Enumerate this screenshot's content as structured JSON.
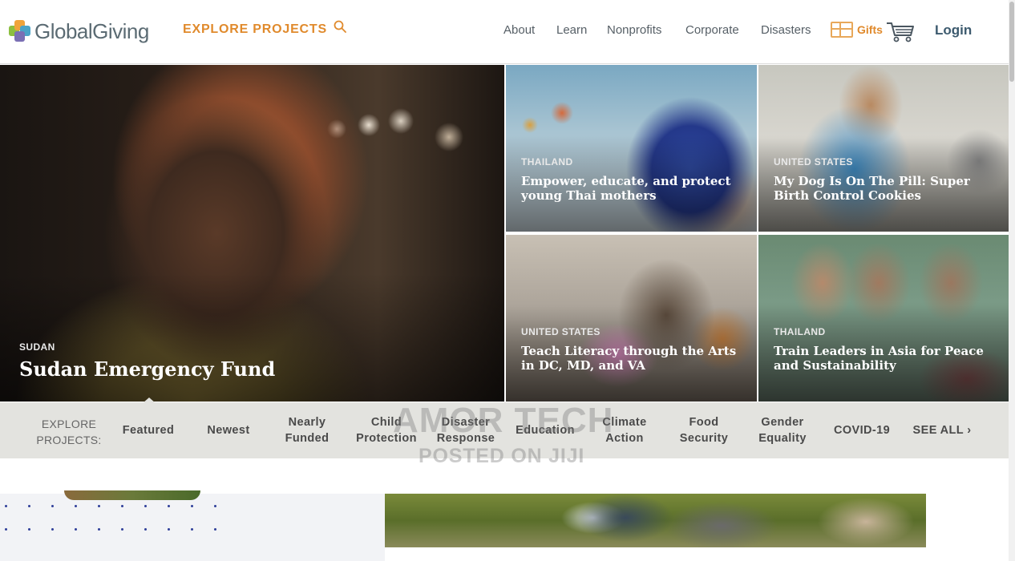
{
  "header": {
    "logo_text": "GlobalGiving",
    "explore_label": "EXPLORE PROJECTS",
    "nav": [
      {
        "label": "About"
      },
      {
        "label": "Learn"
      },
      {
        "label": "Nonprofits"
      },
      {
        "label": "Corporate"
      },
      {
        "label": "Disasters"
      }
    ],
    "gifts_label": "Gifts",
    "login_label": "Login",
    "colors": {
      "accent": "#e08a2c",
      "nav_text": "#565f66",
      "login": "#3c5a6e"
    }
  },
  "hero": {
    "main": {
      "country": "SUDAN",
      "title": "Sudan Emergency Fund"
    },
    "tiles": [
      {
        "country": "THAILAND",
        "title": "Empower, educate, and protect young Thai mothers"
      },
      {
        "country": "UNITED STATES",
        "title": "My Dog Is On The Pill: Super Birth Control Cookies"
      },
      {
        "country": "UNITED STATES",
        "title": "Teach Literacy through the Arts in DC, MD, and VA"
      },
      {
        "country": "THAILAND",
        "title": "Train Leaders in Asia for Peace and Sustainability"
      }
    ]
  },
  "categories": {
    "explore_label": "EXPLORE PROJECTS:",
    "items": [
      {
        "label": "Featured"
      },
      {
        "label": "Newest"
      },
      {
        "label": "Nearly Funded"
      },
      {
        "label": "Child Protection"
      },
      {
        "label": "Disaster Response"
      },
      {
        "label": "Education"
      },
      {
        "label": "Climate Action"
      },
      {
        "label": "Food Security"
      },
      {
        "label": "Gender Equality"
      },
      {
        "label": "COVID-19"
      },
      {
        "label": "SEE ALL ›"
      }
    ]
  },
  "watermark": {
    "line1": "AMOR TECH",
    "line2": "POSTED ON JIJI"
  }
}
